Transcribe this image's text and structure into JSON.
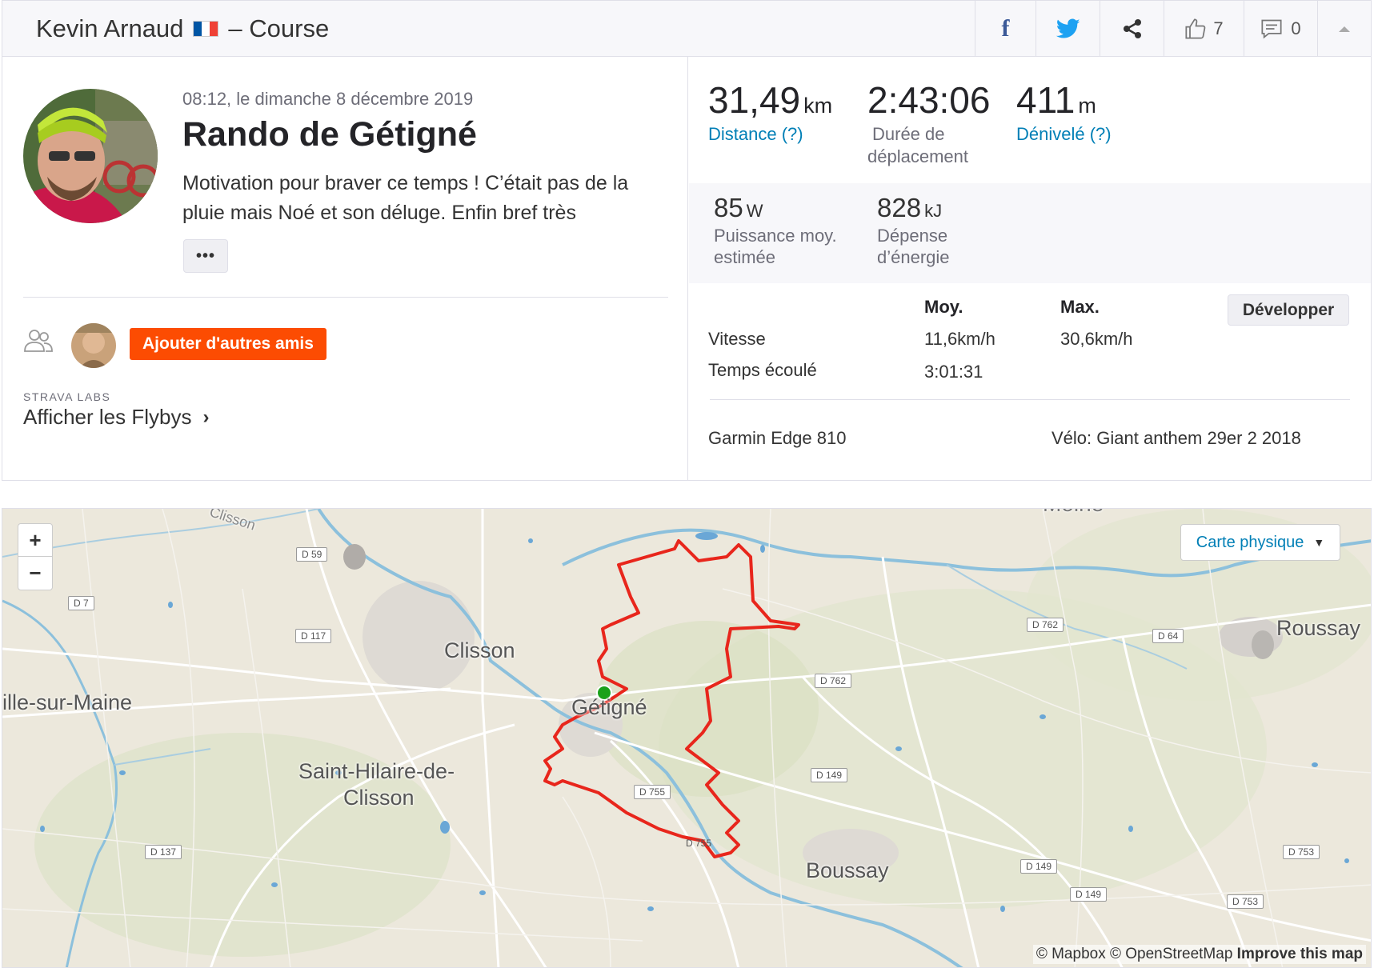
{
  "header": {
    "athlete": "Kevin Arnaud",
    "separator": "–",
    "activity_type": "Course",
    "flag_colors": [
      "#0055a4",
      "#ffffff",
      "#ef4135"
    ],
    "kudos_count": "7",
    "comment_count": "0"
  },
  "activity": {
    "timestamp": "08:12, le dimanche 8 décembre 2019",
    "name": "Rando de Gétigné",
    "description": "Motivation pour braver ce temps ! C’était pas de la pluie mais Noé et son déluge. Enfin bref très",
    "more_label": "•••",
    "add_friends_label": "Ajouter d'autres amis",
    "labs_label": "STRAVA LABS",
    "flybys_label": "Afficher les Flybys",
    "flybys_chevron": "›"
  },
  "stats": {
    "distance": {
      "value": "31,49",
      "unit": "km",
      "label": "Distance (?)"
    },
    "moving_time": {
      "value": "2:43:06",
      "label_line1": "Durée de",
      "label_line2": "déplacement"
    },
    "elevation": {
      "value": "411",
      "unit": "m",
      "label": "Dénivelé (?)"
    },
    "power": {
      "value": "85",
      "unit": "W",
      "label_line1": "Puissance moy.",
      "label_line2": "estimée"
    },
    "energy": {
      "value": "828",
      "unit": "kJ",
      "label_line1": "Dépense",
      "label_line2": "d’énergie"
    },
    "table": {
      "col_avg": "Moy.",
      "col_max": "Max.",
      "expand_label": "Développer",
      "speed_label": "Vitesse",
      "speed_avg": "11,6km/h",
      "speed_max": "30,6km/h",
      "elapsed_label": "Temps écoulé",
      "elapsed_avg": "3:01:31"
    },
    "device": "Garmin Edge 810",
    "bike": "Vélo: Giant anthem 29er 2 2018"
  },
  "map": {
    "zoom_in": "+",
    "zoom_out": "−",
    "map_type": "Carte physique",
    "map_type_caret": "▼",
    "attribution_prefix": "© Mapbox © OpenStreetMap",
    "attribution_link": "Improve this map",
    "route_color": "#e8261c",
    "start_color": "#1aa11a",
    "towns": {
      "clisson_top": "Clisson",
      "moine": "Moine",
      "clisson": "Clisson",
      "getigne": "Gétigné",
      "roussay": "Roussay",
      "maine": "ille-sur-Maine",
      "sainthilaire_1": "Saint-Hilaire-de-",
      "sainthilaire_2": "Clisson",
      "boussay": "Boussay"
    },
    "roads": {
      "d59": "D 59",
      "d7": "D 7",
      "d117": "D 117",
      "d762a": "D 762",
      "d64": "D 64",
      "d762b": "D 762",
      "d149a": "D 149",
      "d755a": "D 755",
      "d755b": "D 755",
      "d137": "D 137",
      "d149b": "D 149",
      "d149c": "D 149",
      "d753a": "D 753",
      "d753b": "D 753"
    }
  }
}
